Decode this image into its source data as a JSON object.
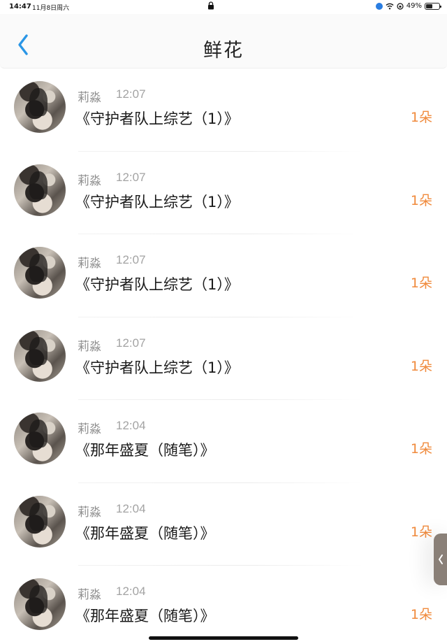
{
  "status_bar": {
    "time": "14:47",
    "date": "11月8日周六",
    "battery": "49%",
    "battery_level": 0.49
  },
  "nav": {
    "title": "鲜花"
  },
  "colors": {
    "accent_blue": "#2a96e6",
    "count_orange": "#f08a3c"
  },
  "items": [
    {
      "author": "莉淼",
      "time": "12:07",
      "title": "《守护者队上综艺（1）》",
      "count": "1朵"
    },
    {
      "author": "莉淼",
      "time": "12:07",
      "title": "《守护者队上综艺（1）》",
      "count": "1朵"
    },
    {
      "author": "莉淼",
      "time": "12:07",
      "title": "《守护者队上综艺（1）》",
      "count": "1朵"
    },
    {
      "author": "莉淼",
      "time": "12:07",
      "title": "《守护者队上综艺（1）》",
      "count": "1朵"
    },
    {
      "author": "莉淼",
      "time": "12:04",
      "title": "《那年盛夏（随笔）》",
      "count": "1朵"
    },
    {
      "author": "莉淼",
      "time": "12:04",
      "title": "《那年盛夏（随笔）》",
      "count": "1朵"
    },
    {
      "author": "莉淼",
      "time": "12:04",
      "title": "《那年盛夏（随笔）》",
      "count": "1朵"
    }
  ]
}
